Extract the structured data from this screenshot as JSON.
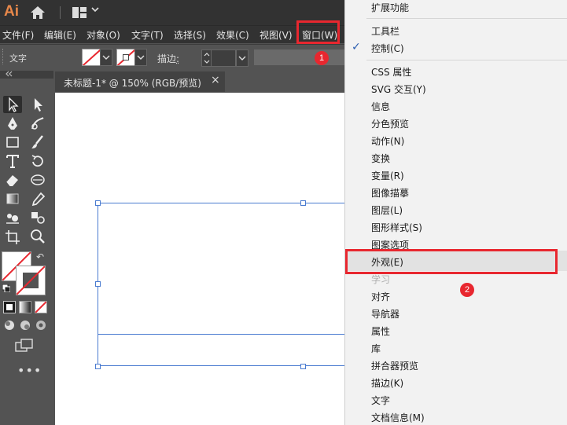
{
  "app": {
    "logo": "Ai"
  },
  "menubar": {
    "items": [
      "文件(F)",
      "编辑(E)",
      "对象(O)",
      "文字(T)",
      "选择(S)",
      "效果(C)",
      "视图(V)",
      "窗口(W)"
    ]
  },
  "control_bar": {
    "label": "文字",
    "stroke_label": "描边",
    "stroke_colon": ":"
  },
  "document_tab": {
    "title": "未标题-1* @ 150% (RGB/预览)",
    "close": "×"
  },
  "annotations": {
    "badge1": "1",
    "badge2": "2"
  },
  "window_menu": {
    "items": [
      {
        "label": "扩展功能",
        "checked": false,
        "disabled": false
      },
      {
        "label": "工具栏",
        "checked": false,
        "disabled": false
      },
      {
        "label": "控制(C)",
        "checked": true,
        "disabled": false
      },
      {
        "label": "CSS 属性",
        "checked": false,
        "disabled": false
      },
      {
        "label": "SVG 交互(Y)",
        "checked": false,
        "disabled": false
      },
      {
        "label": "信息",
        "checked": false,
        "disabled": false
      },
      {
        "label": "分色预览",
        "checked": false,
        "disabled": false
      },
      {
        "label": "动作(N)",
        "checked": false,
        "disabled": false
      },
      {
        "label": "变换",
        "checked": false,
        "disabled": false
      },
      {
        "label": "变量(R)",
        "checked": false,
        "disabled": false
      },
      {
        "label": "图像描摹",
        "checked": false,
        "disabled": false
      },
      {
        "label": "图层(L)",
        "checked": false,
        "disabled": false
      },
      {
        "label": "图形样式(S)",
        "checked": false,
        "disabled": false
      },
      {
        "label": "图案选项",
        "checked": false,
        "disabled": false
      },
      {
        "label": "外观(E)",
        "checked": false,
        "disabled": false,
        "hovered": true
      },
      {
        "label": "学习",
        "checked": false,
        "disabled": true
      },
      {
        "label": "对齐",
        "checked": false,
        "disabled": false
      },
      {
        "label": "导航器",
        "checked": false,
        "disabled": false
      },
      {
        "label": "属性",
        "checked": false,
        "disabled": false
      },
      {
        "label": "库",
        "checked": false,
        "disabled": false
      },
      {
        "label": "拼合器预览",
        "checked": false,
        "disabled": false
      },
      {
        "label": "描边(K)",
        "checked": false,
        "disabled": false
      },
      {
        "label": "文字",
        "checked": false,
        "disabled": false
      },
      {
        "label": "文档信息(M)",
        "checked": false,
        "disabled": false
      }
    ]
  },
  "colors": {
    "accent_red": "#e8272f",
    "check_blue": "#2a5db0",
    "selection_blue": "#4a7bd0",
    "logo_orange": "#e8884a"
  },
  "icons": {
    "check": "✓",
    "chevron": "⌄",
    "swap": "↶",
    "more": "•••"
  }
}
